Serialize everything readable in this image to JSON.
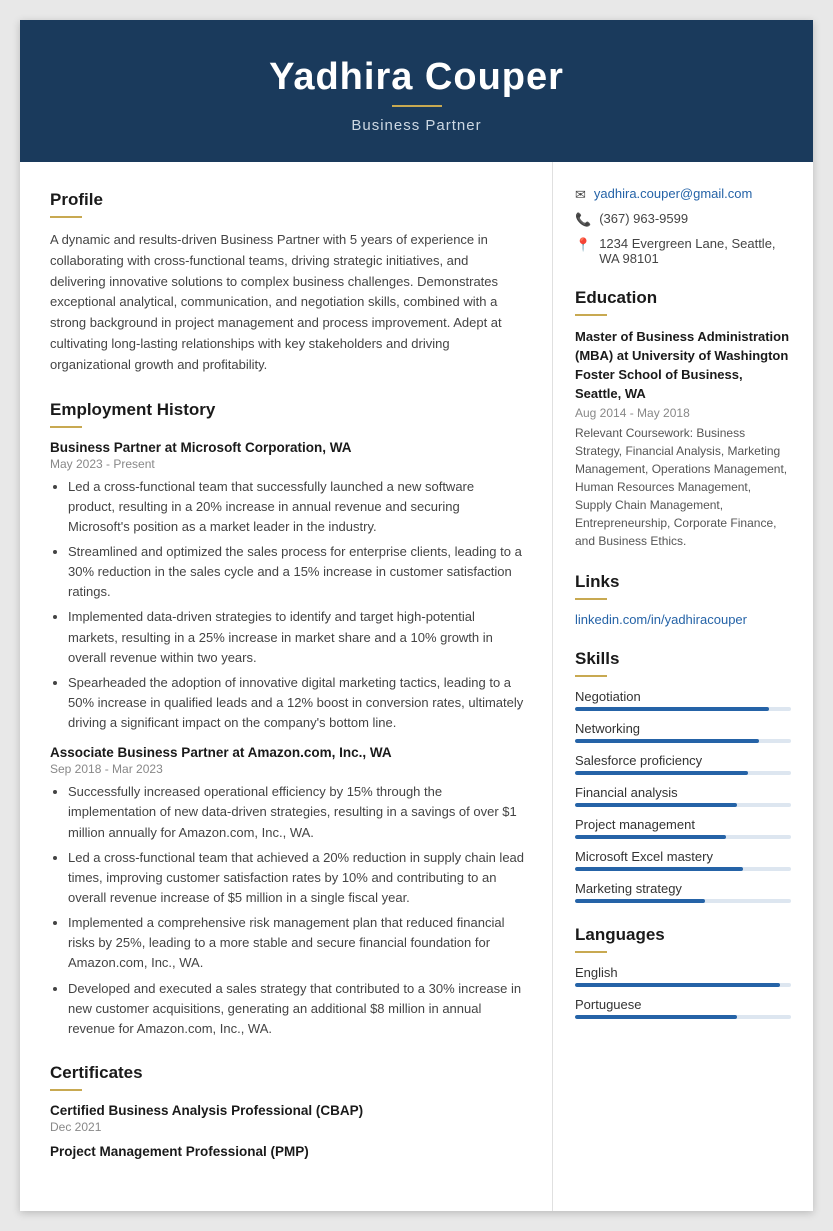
{
  "header": {
    "name": "Yadhira Couper",
    "title": "Business Partner"
  },
  "contact": {
    "email": "yadhira.couper@gmail.com",
    "phone": "(367) 963-9599",
    "address": "1234 Evergreen Lane, Seattle, WA 98101"
  },
  "profile": {
    "section_title": "Profile",
    "text": "A dynamic and results-driven Business Partner with 5 years of experience in collaborating with cross-functional teams, driving strategic initiatives, and delivering innovative solutions to complex business challenges. Demonstrates exceptional analytical, communication, and negotiation skills, combined with a strong background in project management and process improvement. Adept at cultivating long-lasting relationships with key stakeholders and driving organizational growth and profitability."
  },
  "employment": {
    "section_title": "Employment History",
    "jobs": [
      {
        "title": "Business Partner at Microsoft Corporation, WA",
        "dates": "May 2023 - Present",
        "bullets": [
          "Led a cross-functional team that successfully launched a new software product, resulting in a 20% increase in annual revenue and securing Microsoft's position as a market leader in the industry.",
          "Streamlined and optimized the sales process for enterprise clients, leading to a 30% reduction in the sales cycle and a 15% increase in customer satisfaction ratings.",
          "Implemented data-driven strategies to identify and target high-potential markets, resulting in a 25% increase in market share and a 10% growth in overall revenue within two years.",
          "Spearheaded the adoption of innovative digital marketing tactics, leading to a 50% increase in qualified leads and a 12% boost in conversion rates, ultimately driving a significant impact on the company's bottom line."
        ]
      },
      {
        "title": "Associate Business Partner at Amazon.com, Inc., WA",
        "dates": "Sep 2018 - Mar 2023",
        "bullets": [
          "Successfully increased operational efficiency by 15% through the implementation of new data-driven strategies, resulting in a savings of over $1 million annually for Amazon.com, Inc., WA.",
          "Led a cross-functional team that achieved a 20% reduction in supply chain lead times, improving customer satisfaction rates by 10% and contributing to an overall revenue increase of $5 million in a single fiscal year.",
          "Implemented a comprehensive risk management plan that reduced financial risks by 25%, leading to a more stable and secure financial foundation for Amazon.com, Inc., WA.",
          "Developed and executed a sales strategy that contributed to a 30% increase in new customer acquisitions, generating an additional $8 million in annual revenue for Amazon.com, Inc., WA."
        ]
      }
    ]
  },
  "certificates": {
    "section_title": "Certificates",
    "items": [
      {
        "title": "Certified Business Analysis Professional (CBAP)",
        "date": "Dec 2021"
      },
      {
        "title": "Project Management Professional (PMP)",
        "date": ""
      }
    ]
  },
  "education": {
    "section_title": "Education",
    "items": [
      {
        "degree": "Master of Business Administration (MBA) at University of Washington Foster School of Business, Seattle, WA",
        "dates": "Aug 2014 - May 2018",
        "description": "Relevant Coursework: Business Strategy, Financial Analysis, Marketing Management, Operations Management, Human Resources Management, Supply Chain Management, Entrepreneurship, Corporate Finance, and Business Ethics."
      }
    ]
  },
  "links": {
    "section_title": "Links",
    "items": [
      {
        "label": "linkedin.com/in/yadhiracouper",
        "url": "#"
      }
    ]
  },
  "skills": {
    "section_title": "Skills",
    "items": [
      {
        "name": "Negotiation",
        "percent": 90
      },
      {
        "name": "Networking",
        "percent": 85
      },
      {
        "name": "Salesforce proficiency",
        "percent": 80
      },
      {
        "name": "Financial analysis",
        "percent": 75
      },
      {
        "name": "Project management",
        "percent": 70
      },
      {
        "name": "Microsoft Excel mastery",
        "percent": 78
      },
      {
        "name": "Marketing strategy",
        "percent": 60
      }
    ]
  },
  "languages": {
    "section_title": "Languages",
    "items": [
      {
        "name": "English",
        "percent": 95
      },
      {
        "name": "Portuguese",
        "percent": 75
      }
    ]
  }
}
